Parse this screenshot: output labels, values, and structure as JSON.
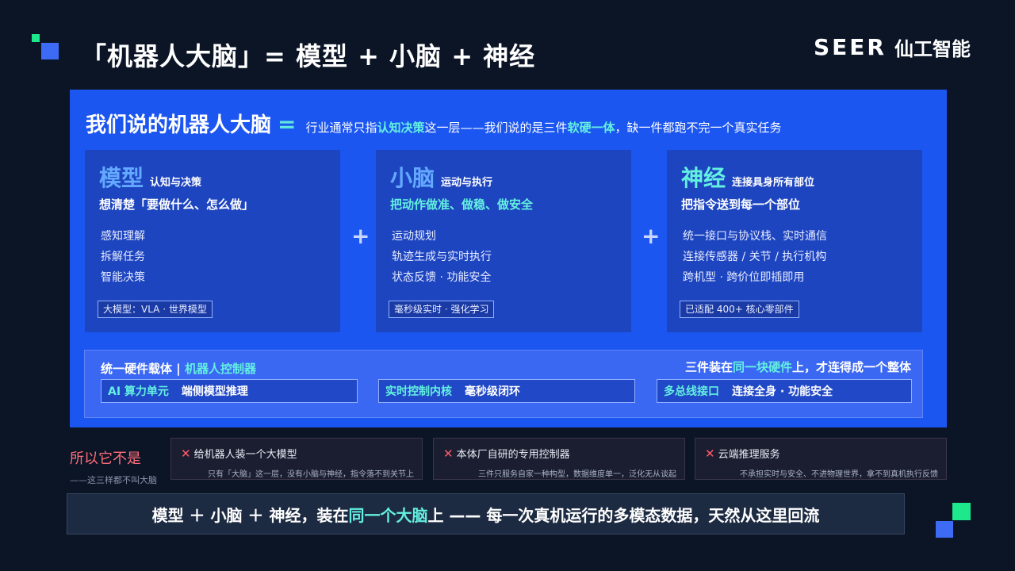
{
  "title": "「机器人大脑」= 模型 + 小脑 + 神经",
  "brand": {
    "latin": "SEER",
    "cn": "仙工智能"
  },
  "headline": {
    "big": "我们说的机器人大脑",
    "eq": "=",
    "pre": "行业通常只指",
    "hl1": "认知决策",
    "mid": "这一层——我们说的是三件",
    "hl2": "软硬一体",
    "post": "，缺一件都跑不完一个真实任务"
  },
  "cards": [
    {
      "name": "模型",
      "tag": "认知与决策",
      "sub": "想清楚「要做什么、怎么做」",
      "items": [
        "感知理解",
        "拆解任务",
        "智能决策"
      ],
      "badge": "大模型：VLA · 世界模型"
    },
    {
      "name": "小脑",
      "tag": "运动与执行",
      "sub": "把动作做准、做稳、做安全",
      "items": [
        "运动规划",
        "轨迹生成与实时执行",
        "状态反馈 · 功能安全"
      ],
      "badge": "毫秒级实时 · 强化学习"
    },
    {
      "name": "神经",
      "tag": "连接具身所有部位",
      "sub": "把指令送到每一个部位",
      "items": [
        "统一接口与协议栈、实时通信",
        "连接传感器 / 关节 / 执行机构",
        "跨机型 · 跨价位即插即用"
      ],
      "badge": "已适配 400+ 核心零部件"
    }
  ],
  "plus": "+",
  "hardware": {
    "left_a": "统一硬件载体 | ",
    "left_b": "机器人控制器",
    "right_a": "三件装在",
    "right_b": "同一块硬件",
    "right_c": "上，才连得成一个整体",
    "chips": [
      {
        "k": "AI 算力单元",
        "v": "端侧模型推理"
      },
      {
        "k": "实时控制内核",
        "v": "毫秒级闭环"
      },
      {
        "k": "多总线接口",
        "v": "连接全身 · 功能安全"
      }
    ]
  },
  "not": {
    "title": "所以它不是",
    "sub": "——这三样都不叫大脑"
  },
  "negatives": [
    {
      "title": "给机器人装一个大模型",
      "desc": "只有「大脑」这一层，没有小脑与神经，指令落不到关节上"
    },
    {
      "title": "本体厂自研的专用控制器",
      "desc": "三件只服务自家一种构型，数据维度单一，泛化无从谈起"
    },
    {
      "title": "云端推理服务",
      "desc": "不承担实时与安全、不进物理世界，拿不到真机执行反馈"
    }
  ],
  "cross": "✕",
  "footer": {
    "a": "模型 ＋ 小脑 ＋ 神经，装在",
    "hl": "同一个大脑",
    "b": "上 —— 每一次真机运行的多模态数据，天然从这里回流"
  },
  "colors": {
    "panel": "#1c56f0",
    "accent": "#63f0e0",
    "green": "#1ee88c",
    "blue": "#3d6bf5",
    "warn": "#ff6d7a"
  }
}
